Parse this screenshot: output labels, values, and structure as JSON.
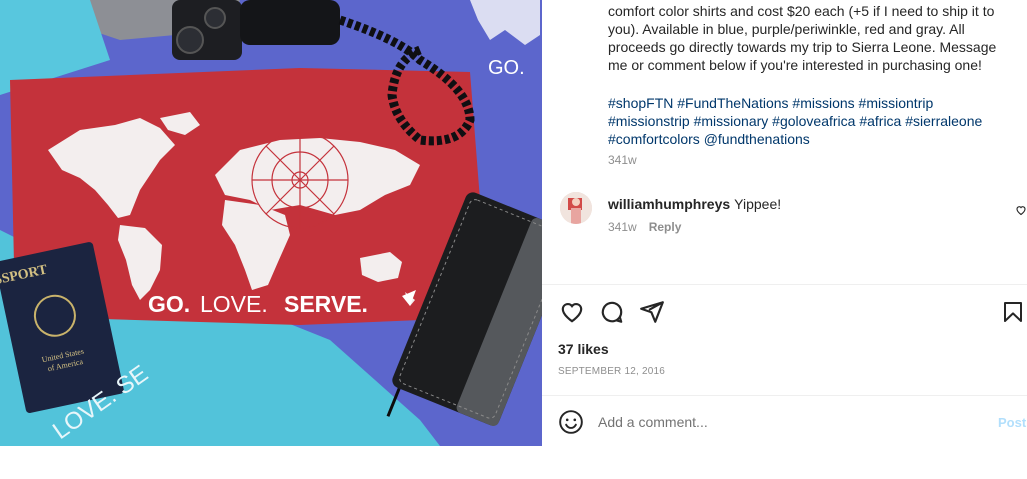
{
  "post": {
    "image_description_hidden": "",
    "caption_lines": [
      "comfort color shirts and cost $20 each (+5 if I need to ship it to",
      "you). Available in blue, purple/periwinkle, red and gray. All",
      "proceeds go directly towards my trip to Sierra Leone. Message",
      "me or comment below if you're interested in purchasing one!"
    ],
    "hashtag_lines": [
      "#shopFTN #FundTheNations #missions #missiontrip",
      "#missionstrip #missionary #goloveafrica #africa #sierraleone",
      "#comfortcolors @fundthenations"
    ],
    "caption_time": "341w",
    "shirt_text": {
      "go": "GO.",
      "love": "LOVE.",
      "serve": "SERVE.",
      "corner_go": "GO.",
      "passport_word": "SSPORT",
      "passport_sub1": "United States",
      "passport_sub2": "of America",
      "teal_text": "LOVE. SE"
    }
  },
  "comment": {
    "username": "williamhumphreys",
    "text": "Yippee!",
    "time": "341w",
    "reply_label": "Reply"
  },
  "actions": {
    "like_icon": "heart-icon",
    "comment_icon": "comment-icon",
    "share_icon": "share-icon",
    "save_icon": "bookmark-icon"
  },
  "likes": "37 likes",
  "date": "SEPTEMBER 12, 2016",
  "add_comment": {
    "placeholder": "Add a comment...",
    "post_label": "Post",
    "emoji_icon": "emoji-icon"
  },
  "colors": {
    "link": "#00376b",
    "muted": "#8e8e8e",
    "post_disabled": "#b2dffc",
    "shirt_red": "#c3323a",
    "shirt_purple": "#5b63c9",
    "shirt_teal": "#4fc6dc"
  }
}
